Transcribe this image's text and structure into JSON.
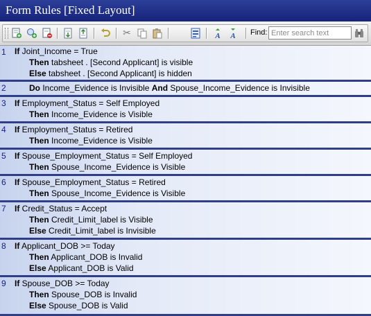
{
  "window": {
    "title": "Form Rules [Fixed Layout]"
  },
  "toolbar": {
    "buttons": [
      {
        "icon": "add-rule-icon"
      },
      {
        "icon": "add-condition-icon"
      },
      {
        "icon": "delete-rule-icon"
      },
      {
        "icon": "move-down-icon"
      },
      {
        "icon": "move-up-icon"
      },
      {
        "icon": "undo-icon"
      },
      {
        "icon": "cut-icon"
      },
      {
        "icon": "copy-icon"
      },
      {
        "icon": "paste-icon"
      },
      {
        "icon": "properties-icon"
      },
      {
        "icon": "sort-ascending-icon"
      },
      {
        "icon": "sort-descending-icon"
      }
    ],
    "find_label": "Find:",
    "find_placeholder": "Enter search text",
    "find_value": ""
  },
  "rules": [
    {
      "number": "1",
      "lines": [
        {
          "keyword": "If",
          "text": " Joint_Income = True"
        },
        {
          "keyword": "Then",
          "text": " tabsheet . [Second Applicant] is visible"
        },
        {
          "keyword": "Else",
          "text": " tabsheet . [Second Applicant] is hidden"
        }
      ]
    },
    {
      "number": "2",
      "lines": [
        {
          "keyword": "Do",
          "text": " Income_Evidence is Invisible ",
          "keyword2": "And",
          "text2": " Spouse_Income_Evidence is Invisible"
        }
      ]
    },
    {
      "number": "3",
      "lines": [
        {
          "keyword": "If",
          "text": " Employment_Status = Self Employed"
        },
        {
          "keyword": "Then",
          "text": " Income_Evidence is Visible"
        }
      ]
    },
    {
      "number": "4",
      "lines": [
        {
          "keyword": "If",
          "text": " Employment_Status = Retired"
        },
        {
          "keyword": "Then",
          "text": " Income_Evidence is Visible"
        }
      ]
    },
    {
      "number": "5",
      "lines": [
        {
          "keyword": "If",
          "text": " Spouse_Employment_Status = Self Employed"
        },
        {
          "keyword": "Then",
          "text": " Spouse_Income_Evidence is Visible"
        }
      ]
    },
    {
      "number": "6",
      "lines": [
        {
          "keyword": "If",
          "text": " Spouse_Employment_Status = Retired"
        },
        {
          "keyword": "Then",
          "text": " Spouse_Income_Evidence is Visible"
        }
      ]
    },
    {
      "number": "7",
      "lines": [
        {
          "keyword": "If",
          "text": " Credit_Status = Accept"
        },
        {
          "keyword": "Then",
          "text": " Credit_Limit_label is Visible"
        },
        {
          "keyword": "Else",
          "text": " Credit_Limit_label is Invisible"
        }
      ]
    },
    {
      "number": "8",
      "lines": [
        {
          "keyword": "If",
          "text": " Applicant_DOB >= Today"
        },
        {
          "keyword": "Then",
          "text": " Applicant_DOB is Invalid"
        },
        {
          "keyword": "Else",
          "text": " Applicant_DOB is Valid"
        }
      ]
    },
    {
      "number": "9",
      "lines": [
        {
          "keyword": "If",
          "text": " Spouse_DOB >= Today"
        },
        {
          "keyword": "Then",
          "text": " Spouse_DOB is Invalid"
        },
        {
          "keyword": "Else",
          "text": " Spouse_DOB is Valid"
        }
      ]
    }
  ]
}
